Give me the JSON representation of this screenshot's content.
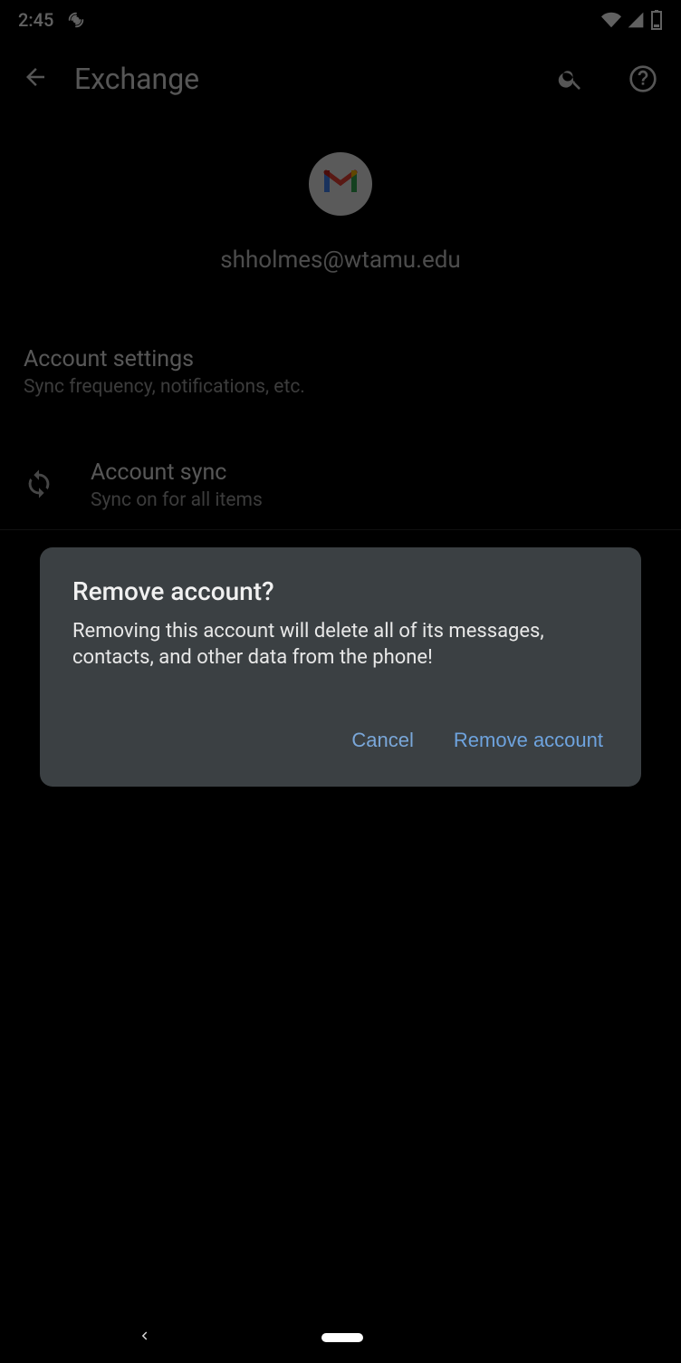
{
  "status_bar": {
    "time": "2:45"
  },
  "app_bar": {
    "title": "Exchange"
  },
  "account": {
    "email": "shholmes@wtamu.edu"
  },
  "settings": {
    "account_settings": {
      "title": "Account settings",
      "sub": "Sync frequency, notifications, etc."
    },
    "account_sync": {
      "title": "Account sync",
      "sub": "Sync on for all items"
    }
  },
  "dialog": {
    "title": "Remove account?",
    "body": "Removing this account will delete all of its messages, contacts, and other data from the phone!",
    "cancel_label": "Cancel",
    "confirm_label": "Remove account"
  }
}
